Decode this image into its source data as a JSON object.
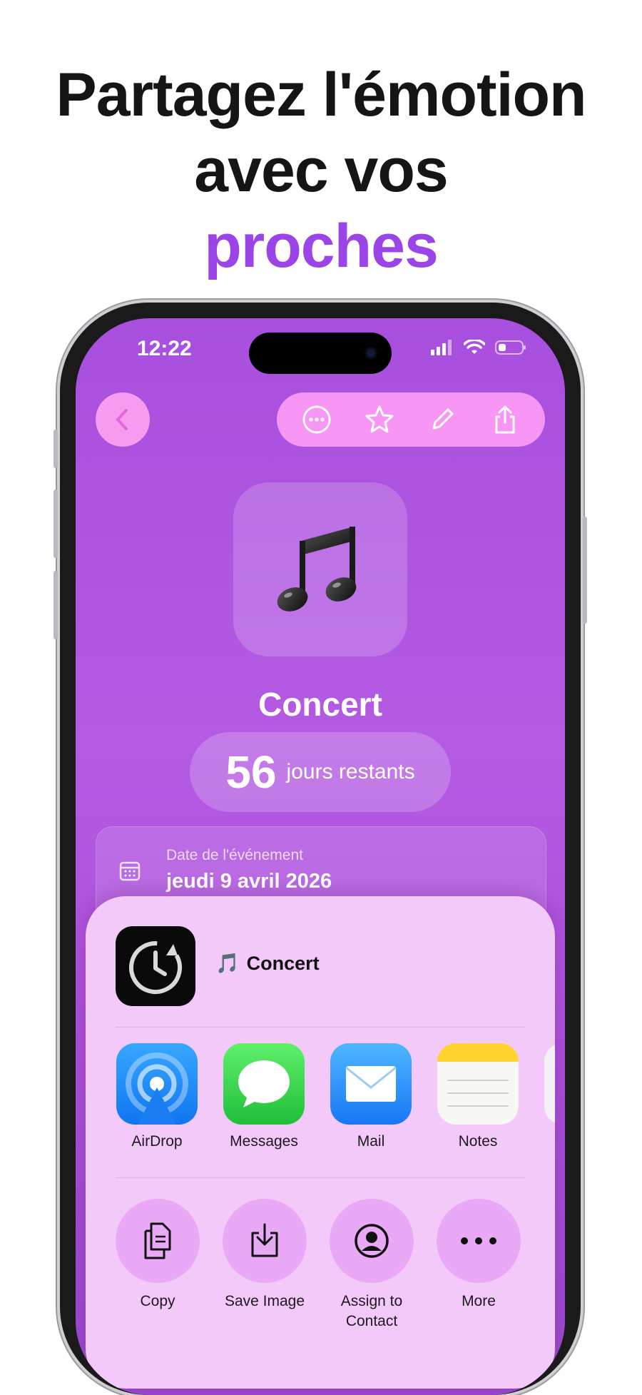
{
  "headline": {
    "line1": "Partagez l'émotion",
    "line2": "avec vos",
    "line3": "proches",
    "accent_color": "#9b45e8"
  },
  "status_bar": {
    "time": "12:22"
  },
  "toolbar": {
    "icons": [
      "back-chevron-icon",
      "ellipsis-circle-icon",
      "star-icon",
      "pencil-icon",
      "share-icon"
    ]
  },
  "event": {
    "emoji": "🎵",
    "title": "Concert",
    "countdown_value": "56",
    "countdown_label": "jours restants",
    "date_label": "Date de l'événement",
    "date_value": "jeudi 9 avril 2026"
  },
  "share_sheet": {
    "item_emoji": "🎵",
    "item_title": "Concert",
    "apps": [
      {
        "label": "AirDrop",
        "icon": "airdrop-icon"
      },
      {
        "label": "Messages",
        "icon": "messages-icon"
      },
      {
        "label": "Mail",
        "icon": "mail-icon"
      },
      {
        "label": "Notes",
        "icon": "notes-icon"
      }
    ],
    "actions": [
      {
        "label": "Copy",
        "icon": "copy-icon"
      },
      {
        "label": "Save Image",
        "icon": "save-image-icon"
      },
      {
        "label": "Assign to Contact",
        "icon": "contact-icon"
      },
      {
        "label": "More",
        "icon": "more-icon"
      }
    ]
  }
}
